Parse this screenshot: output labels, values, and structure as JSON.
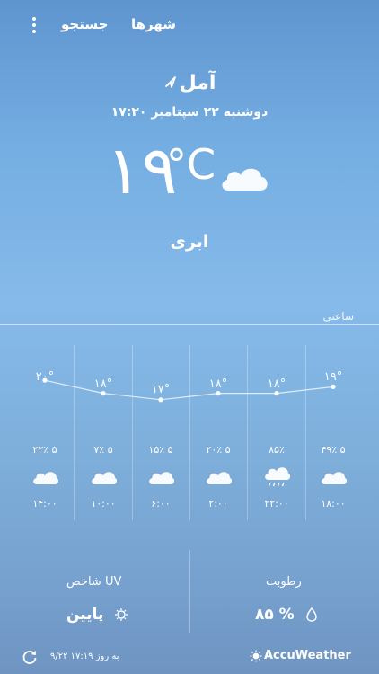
{
  "header": {
    "search_label": "جستجو",
    "cities_label": "شهرها",
    "menu_icon": "kebab-menu-icon"
  },
  "location": {
    "city": "آمل",
    "datetime": "۱۷:۲۰ دوشنبه ۲۲ سپتامبر"
  },
  "current": {
    "temp": "۱۹",
    "unit": "°C",
    "condition": "ابری",
    "icon": "cloud-icon"
  },
  "hourly": {
    "label": "ساعتی",
    "items": [
      {
        "temp": "۲۰°",
        "temp_value": 20,
        "precip": "۲۲٪ ۵",
        "icon": "cloud",
        "time": "۱۴:۰۰"
      },
      {
        "temp": "۱۸°",
        "temp_value": 18,
        "precip": "۷٪ ۵",
        "icon": "cloud",
        "time": "۱۰:۰۰"
      },
      {
        "temp": "۱۷°",
        "temp_value": 17,
        "precip": "۱۵٪ ۵",
        "icon": "cloud",
        "time": "۶:۰۰"
      },
      {
        "temp": "۱۸°",
        "temp_value": 18,
        "precip": "۲۰٪ ۵",
        "icon": "cloud",
        "time": "۲:۰۰"
      },
      {
        "temp": "۱۸°",
        "temp_value": 18,
        "precip": "۸۵٪",
        "icon": "cloud-rain",
        "time": "۲۲:۰۰"
      },
      {
        "temp": "۱۹°",
        "temp_value": 19,
        "precip": "۴۹٪ ۵",
        "icon": "cloud",
        "time": "۱۸:۰۰"
      }
    ]
  },
  "uv": {
    "title": "شاخص UV",
    "value": "پایین",
    "icon": "uv-sun-icon"
  },
  "humidity": {
    "title": "رطوبت",
    "value": "۸۵ %",
    "icon": "droplet-icon"
  },
  "footer": {
    "updated": "۹/۲۲ ۱۷:۱۹ به روز",
    "brand": "AccuWeather"
  }
}
